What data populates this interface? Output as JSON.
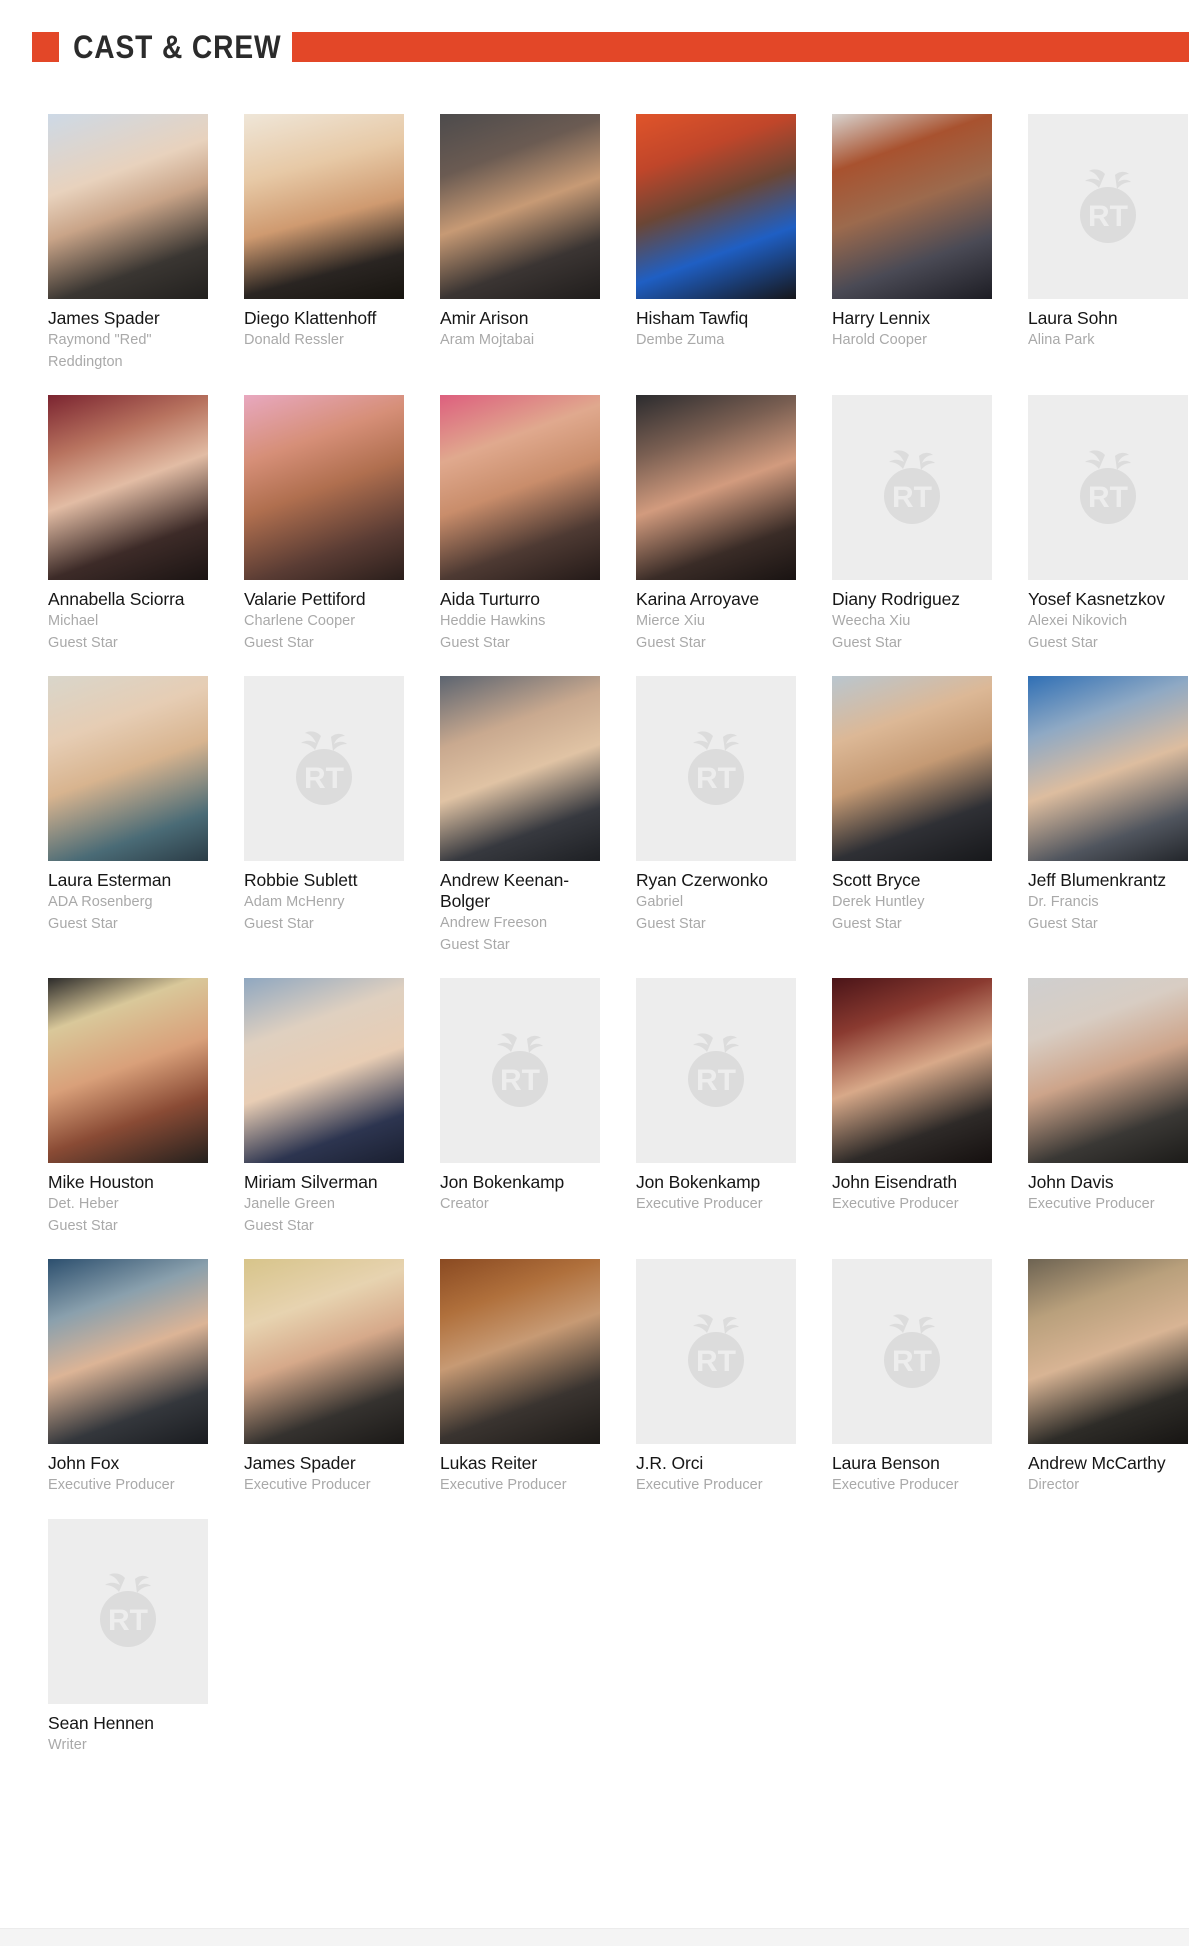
{
  "header": {
    "title": "Cast & Crew",
    "accent_color": "#e34728"
  },
  "colors": {
    "name_text": "#161616",
    "role_text": "#a9a9a9",
    "placeholder_bg": "#ededed",
    "placeholder_fg": "#dcdcdc"
  },
  "placeholder": {
    "icon": "rt-tomato-icon",
    "label": "RT"
  },
  "cast": [
    {
      "name": "James Spader",
      "role": "Raymond \"Red\" Reddington",
      "credit": "",
      "has_photo": true,
      "photo_class": "ph-spader"
    },
    {
      "name": "Diego Klattenhoff",
      "role": "Donald Ressler",
      "credit": "",
      "has_photo": true,
      "photo_class": "ph-klattenhoff"
    },
    {
      "name": "Amir Arison",
      "role": "Aram Mojtabai",
      "credit": "",
      "has_photo": true,
      "photo_class": "ph-arison"
    },
    {
      "name": "Hisham Tawfiq",
      "role": "Dembe Zuma",
      "credit": "",
      "has_photo": true,
      "photo_class": "ph-tawfiq"
    },
    {
      "name": "Harry Lennix",
      "role": "Harold Cooper",
      "credit": "",
      "has_photo": true,
      "photo_class": "ph-lennix"
    },
    {
      "name": "Laura Sohn",
      "role": "Alina Park",
      "credit": "",
      "has_photo": false,
      "photo_class": ""
    },
    {
      "name": "Annabella Sciorra",
      "role": "Michael",
      "credit": "Guest Star",
      "has_photo": true,
      "photo_class": "ph-sciorra"
    },
    {
      "name": "Valarie Pettiford",
      "role": "Charlene Cooper",
      "credit": "Guest Star",
      "has_photo": true,
      "photo_class": "ph-pettiford"
    },
    {
      "name": "Aida Turturro",
      "role": "Heddie Hawkins",
      "credit": "Guest Star",
      "has_photo": true,
      "photo_class": "ph-turturro"
    },
    {
      "name": "Karina Arroyave",
      "role": "Mierce Xiu",
      "credit": "Guest Star",
      "has_photo": true,
      "photo_class": "ph-arroyave"
    },
    {
      "name": "Diany Rodriguez",
      "role": "Weecha Xiu",
      "credit": "Guest Star",
      "has_photo": false,
      "photo_class": ""
    },
    {
      "name": "Yosef Kasnetzkov",
      "role": "Alexei Nikovich",
      "credit": "Guest Star",
      "has_photo": false,
      "photo_class": ""
    },
    {
      "name": "Laura Esterman",
      "role": "ADA Rosenberg",
      "credit": "Guest Star",
      "has_photo": true,
      "photo_class": "ph-esterman"
    },
    {
      "name": "Robbie Sublett",
      "role": "Adam McHenry",
      "credit": "Guest Star",
      "has_photo": false,
      "photo_class": ""
    },
    {
      "name": "Andrew Keenan-Bolger",
      "role": "Andrew Freeson",
      "credit": "Guest Star",
      "has_photo": true,
      "photo_class": "ph-keenan"
    },
    {
      "name": "Ryan Czerwonko",
      "role": "Gabriel",
      "credit": "Guest Star",
      "has_photo": false,
      "photo_class": ""
    },
    {
      "name": "Scott Bryce",
      "role": "Derek Huntley",
      "credit": "Guest Star",
      "has_photo": true,
      "photo_class": "ph-bryce"
    },
    {
      "name": "Jeff Blumenkrantz",
      "role": "Dr. Francis",
      "credit": "Guest Star",
      "has_photo": true,
      "photo_class": "ph-blumen"
    },
    {
      "name": "Mike Houston",
      "role": "Det. Heber",
      "credit": "Guest Star",
      "has_photo": true,
      "photo_class": "ph-houston"
    },
    {
      "name": "Miriam Silverman",
      "role": "Janelle Green",
      "credit": "Guest Star",
      "has_photo": true,
      "photo_class": "ph-silverman"
    },
    {
      "name": "Jon Bokenkamp",
      "role": "Creator",
      "credit": "",
      "has_photo": false,
      "photo_class": ""
    },
    {
      "name": "Jon Bokenkamp",
      "role": "Executive Producer",
      "credit": "",
      "has_photo": false,
      "photo_class": ""
    },
    {
      "name": "John Eisendrath",
      "role": "Executive Producer",
      "credit": "",
      "has_photo": true,
      "photo_class": "ph-eisendrath"
    },
    {
      "name": "John Davis",
      "role": "Executive Producer",
      "credit": "",
      "has_photo": true,
      "photo_class": "ph-davis"
    },
    {
      "name": "John Fox",
      "role": "Executive Producer",
      "credit": "",
      "has_photo": true,
      "photo_class": "ph-fox"
    },
    {
      "name": "James Spader",
      "role": "Executive Producer",
      "credit": "",
      "has_photo": true,
      "photo_class": "ph-spader2"
    },
    {
      "name": "Lukas Reiter",
      "role": "Executive Producer",
      "credit": "",
      "has_photo": true,
      "photo_class": "ph-reiter"
    },
    {
      "name": "J.R. Orci",
      "role": "Executive Producer",
      "credit": "",
      "has_photo": false,
      "photo_class": ""
    },
    {
      "name": "Laura Benson",
      "role": "Executive Producer",
      "credit": "",
      "has_photo": false,
      "photo_class": ""
    },
    {
      "name": "Andrew McCarthy",
      "role": "Director",
      "credit": "",
      "has_photo": true,
      "photo_class": "ph-mccarthy"
    },
    {
      "name": "Sean Hennen",
      "role": "Writer",
      "credit": "",
      "has_photo": false,
      "photo_class": ""
    }
  ]
}
